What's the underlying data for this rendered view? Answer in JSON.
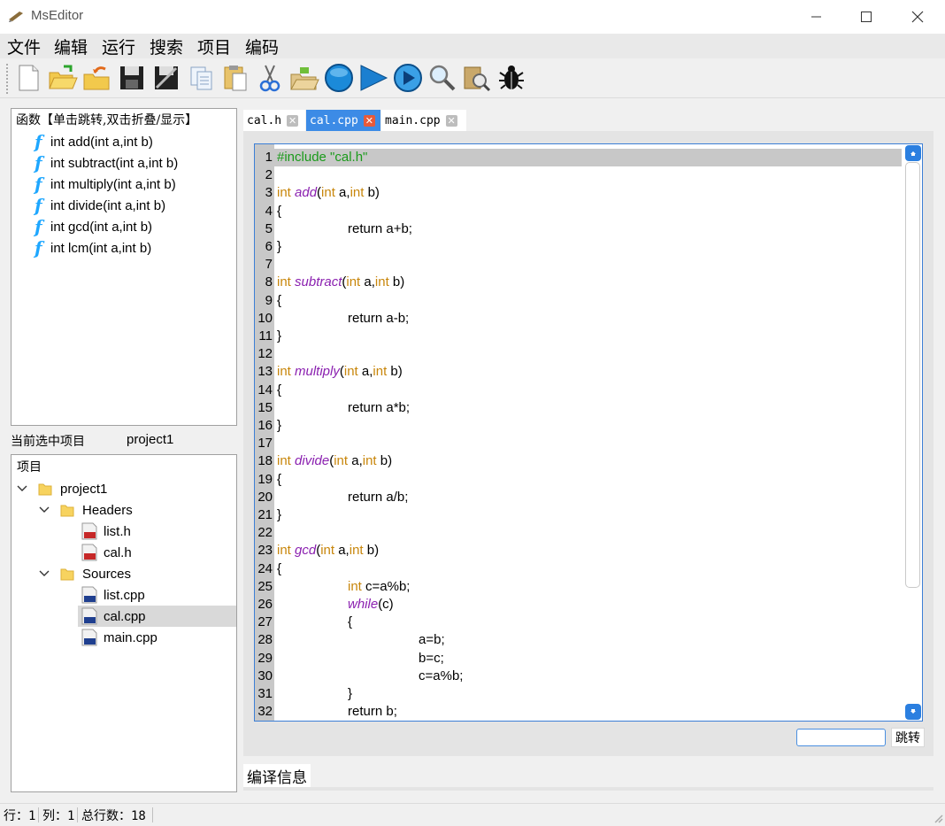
{
  "window": {
    "title": "MsEditor"
  },
  "menu": [
    "文件",
    "编辑",
    "运行",
    "搜索",
    "项目",
    "编码"
  ],
  "toolbar_icons": [
    "new-file-icon",
    "open-folder-icon",
    "open-recent-icon",
    "save-icon",
    "save-all-icon",
    "copy-icon",
    "paste-icon",
    "cut-icon",
    "open-project-icon",
    "stop-icon",
    "run-icon",
    "step-run-icon",
    "search-icon",
    "search-files-icon",
    "debug-icon"
  ],
  "functions": {
    "title": "函数【单击跳转,双击折叠/显示】",
    "items": [
      "int add(int a,int b)",
      "int subtract(int a,int b)",
      "int multiply(int a,int b)",
      "int divide(int a,int b)",
      "int gcd(int a,int b)",
      "int lcm(int a,int b)"
    ]
  },
  "project": {
    "current_label": "当前选中项目",
    "current_value": "project1",
    "tree_header": "项目",
    "root": "project1",
    "headers_label": "Headers",
    "headers": [
      "list.h",
      "cal.h"
    ],
    "sources_label": "Sources",
    "sources": [
      "list.cpp",
      "cal.cpp",
      "main.cpp"
    ],
    "selected": "cal.cpp"
  },
  "tabs": [
    {
      "label": "cal.h",
      "active": false
    },
    {
      "label": "cal.cpp",
      "active": true
    },
    {
      "label": "main.cpp",
      "active": false
    }
  ],
  "editor": {
    "lines": [
      "#include \"cal.h\"",
      "",
      "int add(int a,int b)",
      "{",
      "\t\treturn a+b;",
      "}",
      "",
      "int subtract(int a,int b)",
      "{",
      "\t\treturn a-b;",
      "}",
      "",
      "int multiply(int a,int b)",
      "{",
      "\t\treturn a*b;",
      "}",
      "",
      "int divide(int a,int b)",
      "{",
      "\t\treturn a/b;",
      "}",
      "",
      "int gcd(int a,int b)",
      "{",
      "\t\tint c=a%b;",
      "\t\twhile(c)",
      "\t\t{",
      "\t\t\t\ta=b;",
      "\t\t\t\tb=c;",
      "\t\t\t\tc=a%b;",
      "\t\t}",
      "\t\treturn b;"
    ]
  },
  "jump": {
    "button": "跳转",
    "value": ""
  },
  "compile_tab": "编译信息",
  "status": {
    "row": "行：1",
    "col": "列：1",
    "total": "总行数：18"
  },
  "colors": {
    "accent": "#3c7fd6",
    "keyword": "#c8860b",
    "function": "#8b21b0",
    "preprocessor": "#1a9a1a",
    "func_icon": "#1ea7ff"
  }
}
